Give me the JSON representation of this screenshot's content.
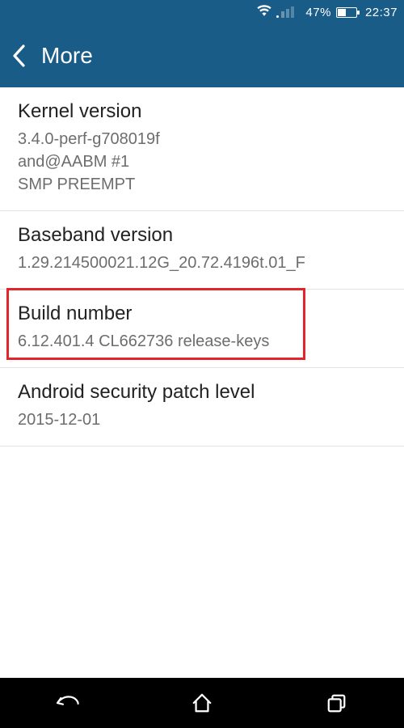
{
  "statusbar": {
    "battery_pct": "47%",
    "clock": "22:37"
  },
  "appbar": {
    "title": "More"
  },
  "rows": [
    {
      "label": "Kernel version",
      "value": "3.4.0-perf-g708019f\nand@AABM #1\nSMP PREEMPT"
    },
    {
      "label": "Baseband version",
      "value": "1.29.214500021.12G_20.72.4196t.01_F"
    },
    {
      "label": "Build number",
      "value": "6.12.401.4 CL662736 release-keys"
    },
    {
      "label": "Android security patch level",
      "value": "2015-12-01"
    }
  ],
  "highlight_row_index": 2
}
